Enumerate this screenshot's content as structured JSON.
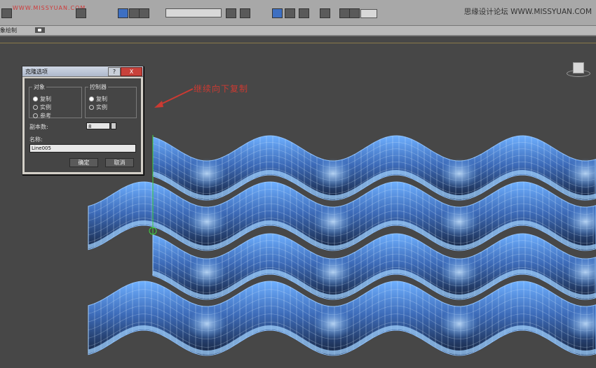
{
  "toolbar": {
    "watermark_text": "WWW.MISSYUAN.COM",
    "site_text": "思缘设计论坛 WWW.MISSYUAN.COM"
  },
  "ribbon": {
    "label": "象绘制"
  },
  "dialog": {
    "title": "克隆选项",
    "help_label": "?",
    "close_label": "X",
    "object_group": {
      "legend": "对象",
      "options": [
        "复制",
        "实例",
        "参考"
      ],
      "selected": "复制"
    },
    "controller_group": {
      "legend": "控制器",
      "options": [
        "复制",
        "实例"
      ],
      "selected": "复制"
    },
    "copies_label": "副本数:",
    "copies_value": "8",
    "name_label": "名称:",
    "name_value": "Line005",
    "ok_label": "确定",
    "cancel_label": "取消"
  },
  "annotation": {
    "text": "继续向下复制",
    "color": "#cc3a32"
  },
  "colors": {
    "viewport_bg": "#474747",
    "mesh_blue": "#6aa8f0",
    "mesh_dark": "#1e2d4a"
  }
}
